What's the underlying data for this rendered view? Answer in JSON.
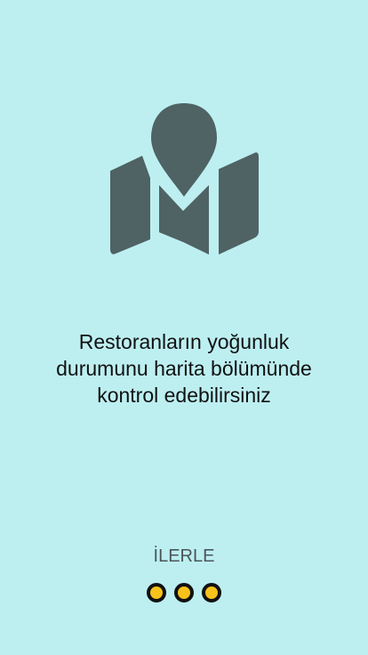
{
  "onboarding": {
    "icon": "map-pin-icon",
    "icon_color": "#4F6264",
    "background_color": "#BDEFF1",
    "message": "Restoranların yoğunluk\ndurumunu harita bölümünde\nkontrol edebilirsiniz",
    "next_label": "İLERLE",
    "accent_color": "#F7C21B",
    "pager": {
      "total": 3,
      "current": 3
    }
  }
}
